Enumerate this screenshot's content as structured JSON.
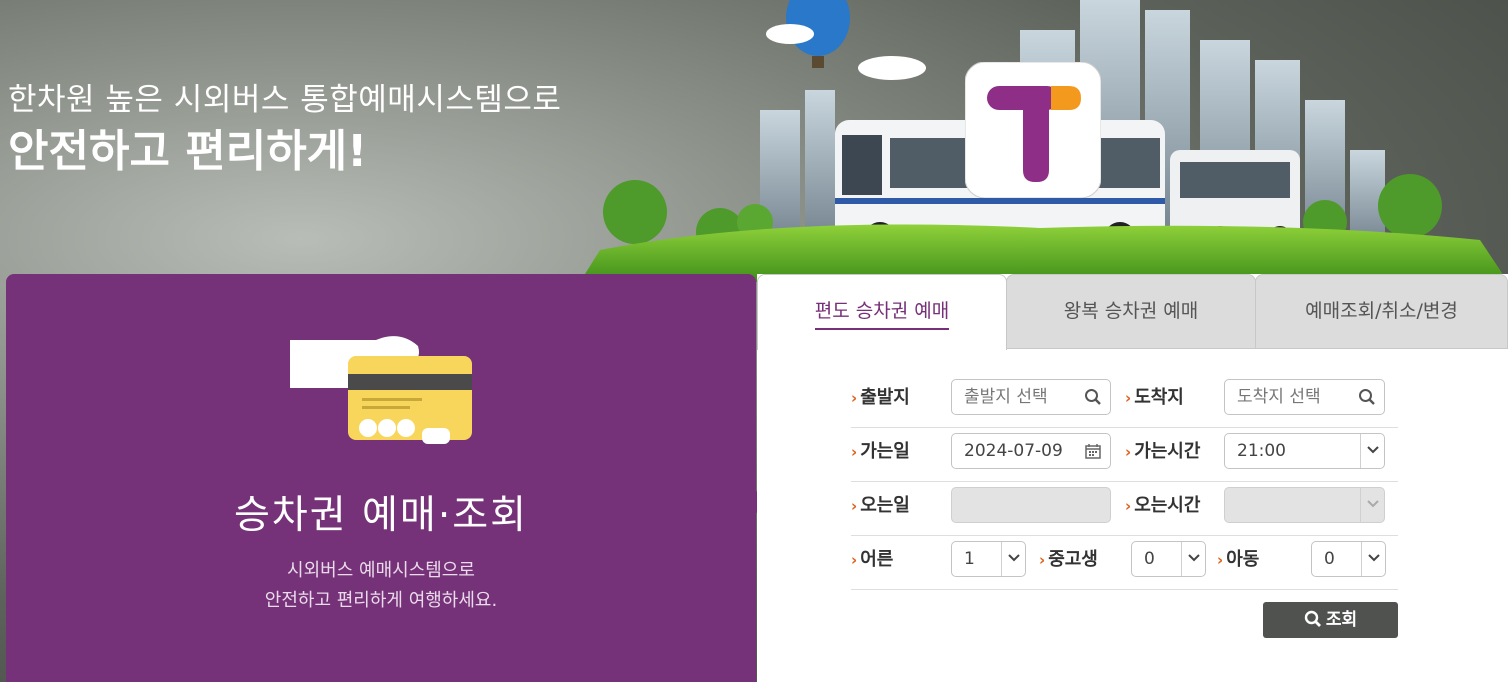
{
  "hero": {
    "line1": "한차원 높은 시외버스 통합예매시스템으로",
    "line2": "안전하고 편리하게!"
  },
  "left_panel": {
    "title": "승차권 예매·조회",
    "desc_line1": "시외버스 예매시스템으로",
    "desc_line2": "안전하고 편리하게 여행하세요."
  },
  "tabs": [
    {
      "label": "편도 승차권 예매",
      "active": true
    },
    {
      "label": "왕복 승차권 예매",
      "active": false
    },
    {
      "label": "예매조회/취소/변경",
      "active": false
    }
  ],
  "form": {
    "departure": {
      "label": "출발지",
      "placeholder": "출발지 선택"
    },
    "arrival": {
      "label": "도착지",
      "placeholder": "도착지 선택"
    },
    "go_date": {
      "label": "가는일",
      "value": "2024-07-09"
    },
    "go_time": {
      "label": "가는시간",
      "value": "21:00"
    },
    "return_date": {
      "label": "오는일",
      "value": ""
    },
    "return_time": {
      "label": "오는시간",
      "value": ""
    },
    "adult": {
      "label": "어른",
      "value": "1"
    },
    "youth": {
      "label": "중고생",
      "value": "0"
    },
    "child": {
      "label": "아동",
      "value": "0"
    }
  },
  "search_button": {
    "label": "조회"
  },
  "colors": {
    "purple": "#763278",
    "accent_orange": "#e0601c",
    "button_dark": "#4f524f"
  },
  "icons": [
    "search-icon",
    "calendar-icon",
    "chevron-down-icon",
    "t-logo-icon",
    "card-payment-icon"
  ]
}
